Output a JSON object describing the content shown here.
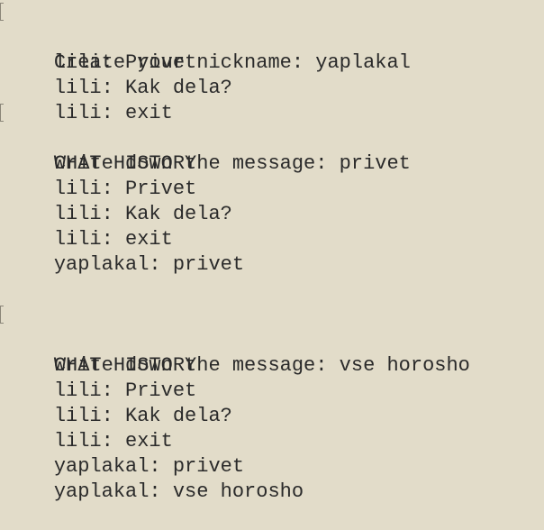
{
  "terminal": {
    "background_color": "#e2dcc9",
    "text_color": "#2a2a2a",
    "lines": [
      {
        "kind": "prompt",
        "text": "Create your nickname: yaplakal"
      },
      {
        "kind": "output",
        "text": "lili: Privet"
      },
      {
        "kind": "output",
        "text": "lili: Kak dela?"
      },
      {
        "kind": "output",
        "text": "lili: exit"
      },
      {
        "kind": "prompt",
        "text": "Write down the message: privet"
      },
      {
        "kind": "output",
        "text": "CHAT HISTORY"
      },
      {
        "kind": "output",
        "text": "lili: Privet"
      },
      {
        "kind": "output",
        "text": "lili: Kak dela?"
      },
      {
        "kind": "output",
        "text": "lili: exit"
      },
      {
        "kind": "output",
        "text": "yaplakal: privet"
      },
      {
        "kind": "blank",
        "text": ""
      },
      {
        "kind": "blank",
        "text": ""
      },
      {
        "kind": "prompt",
        "text": "Write down the message: vse horosho"
      },
      {
        "kind": "output",
        "text": "CHAT HISTORY"
      },
      {
        "kind": "output",
        "text": "lili: Privet"
      },
      {
        "kind": "output",
        "text": "lili: Kak dela?"
      },
      {
        "kind": "output",
        "text": "lili: exit"
      },
      {
        "kind": "output",
        "text": "yaplakal: privet"
      },
      {
        "kind": "output",
        "text": "yaplakal: vse horosho"
      }
    ]
  }
}
